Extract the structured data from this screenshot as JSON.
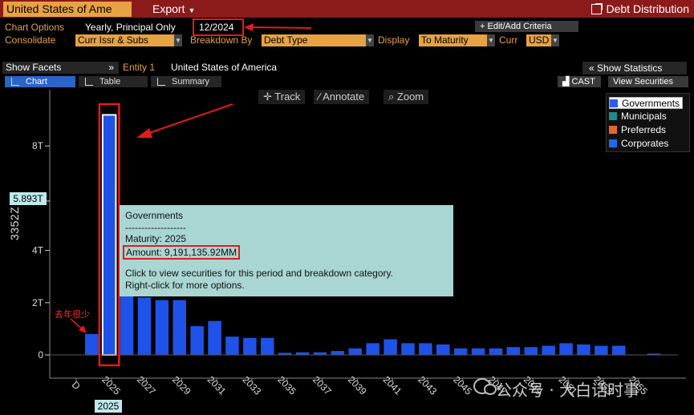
{
  "header": {
    "title": "United States of Ame",
    "export_label": "Export",
    "debt_distribution": "Debt Distribution"
  },
  "options": {
    "chart_options_label": "Chart Options",
    "chart_options_value": "Yearly, Principal Only",
    "date": "12/2024",
    "edit_criteria": "Edit/Add Criteria",
    "consolidate_label": "Consolidate",
    "consolidate_value": "Curr Issr & Subs",
    "breakdown_label": "Breakdown By",
    "breakdown_value": "Debt Type",
    "display_label": "Display",
    "display_value": "To Maturity",
    "curr_label": "Curr",
    "curr_value": "USD"
  },
  "facets": {
    "show_facets": "Show Facets",
    "entity_label": "Entity 1",
    "entity_value": "United States of America",
    "show_statistics": "Show Statistics"
  },
  "tabs": [
    {
      "label": "Chart",
      "active": true
    },
    {
      "label": "Table",
      "active": false
    },
    {
      "label": "Summary",
      "active": false
    }
  ],
  "right_buttons": {
    "cast": "CAST",
    "view_securities": "View Securities"
  },
  "chart_tools": [
    "Track",
    "Annotate",
    "Zoom"
  ],
  "tooltip": {
    "title": "Governments",
    "separator": "-------------------",
    "maturity": "Maturity: 2025",
    "amount": "Amount: 9,191,135.92MM",
    "line1": "Click to view securities for this period and breakdown category.",
    "line2": "Right-click for more options."
  },
  "reference_label": "5.893T",
  "selected_x": "2025",
  "y_axis_title": "3352Z",
  "annotation_cn": "去年很少",
  "watermark": "公众号 · 大白话时事",
  "colors": {
    "title_bar": "#8b1a1a",
    "accent_orange": "#e6a243",
    "bar_blue": "#1f52e8",
    "highlight_red": "#e31b1b",
    "tooltip_bg": "#a9d6d2"
  },
  "chart_data": {
    "type": "bar",
    "ylabel": "3352Z",
    "ylim": [
      0,
      10
    ],
    "y_unit": "T",
    "y_ticks": [
      "0",
      "2T",
      "4T",
      "8T"
    ],
    "x_ticks": [
      "D",
      "2025",
      "2027",
      "2029",
      "2031",
      "2033",
      "2035",
      "2037",
      "2039",
      "2041",
      "2043",
      "2045",
      "2047",
      "2049",
      "2051",
      "2053",
      "2055"
    ],
    "legend": [
      {
        "name": "Governments",
        "color": "#2d5af0"
      },
      {
        "name": "Municipals",
        "color": "#1f8a8a"
      },
      {
        "name": "Preferreds",
        "color": "#e8662a"
      },
      {
        "name": "Corporates",
        "color": "#1f6ae8"
      }
    ],
    "legend_position": "top-right",
    "reference_value": 5.893,
    "series": [
      {
        "name": "Governments",
        "categories": [
          "2024",
          "2025",
          "2026",
          "2027",
          "2028",
          "2029",
          "2030",
          "2031",
          "2032",
          "2033",
          "2034",
          "2035",
          "2036",
          "2037",
          "2038",
          "2039",
          "2040",
          "2041",
          "2042",
          "2043",
          "2044",
          "2045",
          "2046",
          "2047",
          "2048",
          "2049",
          "2050",
          "2051",
          "2052",
          "2053",
          "2054",
          "2055",
          "2056"
        ],
        "values": [
          0.8,
          9.19,
          2.7,
          2.2,
          2.1,
          2.1,
          1.1,
          1.3,
          0.7,
          0.65,
          0.65,
          0.08,
          0.1,
          0.1,
          0.15,
          0.25,
          0.45,
          0.6,
          0.45,
          0.45,
          0.4,
          0.25,
          0.25,
          0.25,
          0.3,
          0.3,
          0.35,
          0.45,
          0.4,
          0.35,
          0.35,
          0,
          0.05
        ]
      }
    ]
  }
}
